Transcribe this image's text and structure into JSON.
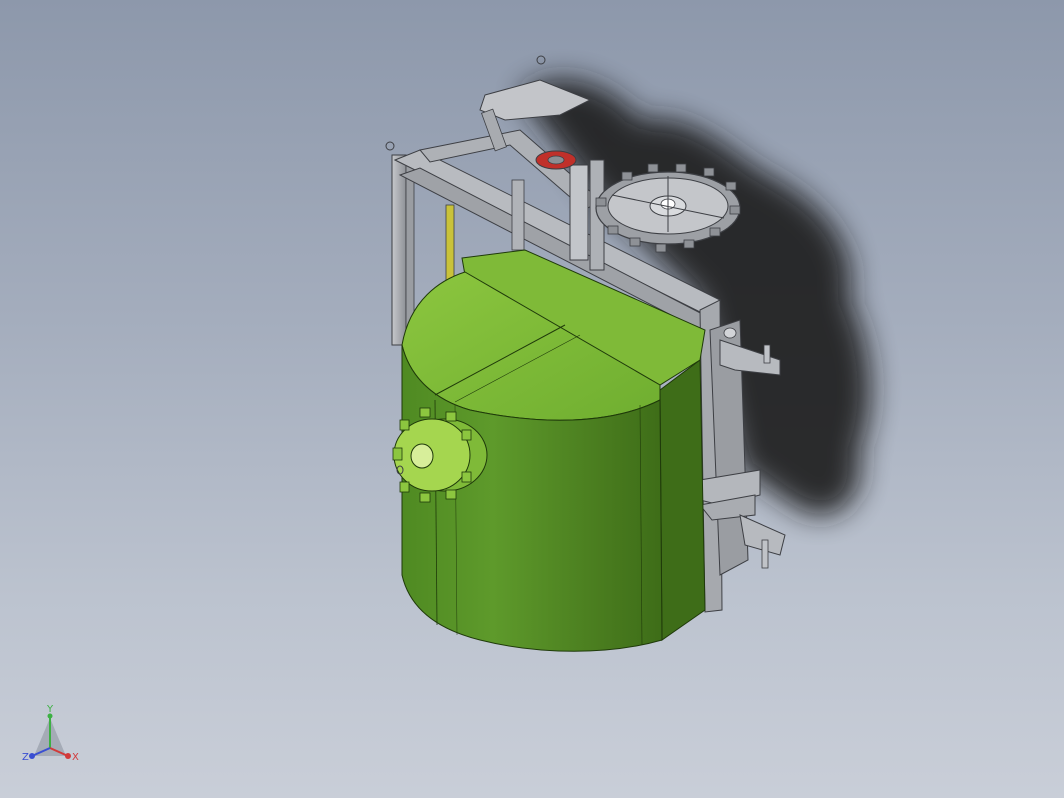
{
  "viewport": {
    "background_top": "#8d98ab",
    "background_bottom": "#c9ced8"
  },
  "model": {
    "tank_color": "#5f9a2c",
    "tank_highlight": "#8cc63f",
    "frame_color": "#a9acb2",
    "shadow_color": "#1c1c1c",
    "accent_red": "#c0302a"
  },
  "triad": {
    "x_label": "X",
    "y_label": "Y",
    "z_label": "Z",
    "x_color": "#d23a3a",
    "y_color": "#3cb043",
    "z_color": "#3a4fd2"
  }
}
